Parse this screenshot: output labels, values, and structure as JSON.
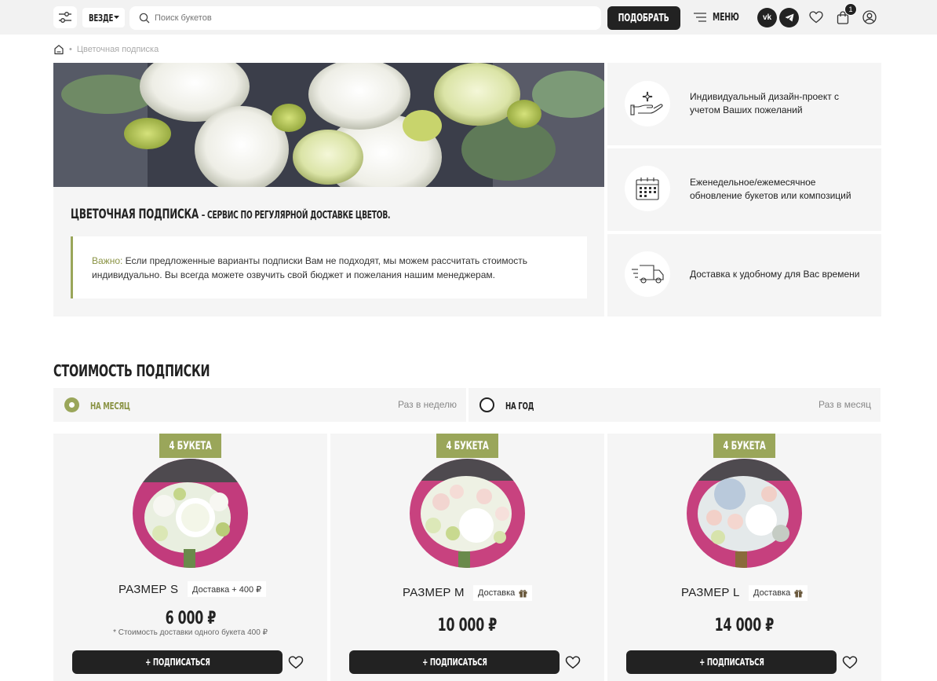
{
  "header": {
    "where_label": "ВЕЗДЕ",
    "search_placeholder": "Поиск букетов",
    "pick_label": "ПОДОБРАТЬ",
    "menu_label": "МЕНЮ",
    "social_vk": "vk",
    "cart_count": "1"
  },
  "breadcrumb": {
    "separator": "•",
    "current": "Цветочная подписка"
  },
  "hero": {
    "title": "ЦВЕТОЧНАЯ ПОДПИСКА",
    "subtitle": "– СЕРВИС ПО РЕГУЛЯРНОЙ ДОСТАВКЕ ЦВЕТОВ.",
    "note_label": "Важно:",
    "note_text": " Если предложенные варианты подписки Вам не подходят, мы можем рассчитать стоимость индивидуально. Вы всегда можете озвучить свой бюджет и пожелания нашим менеджерам."
  },
  "features": [
    {
      "text": "Индивидуальный дизайн-проект с учетом Ваших пожеланий",
      "icon": "hand-flower-icon"
    },
    {
      "text": "Еженедельное/ежемесячное обновление букетов или композиций",
      "icon": "calendar-icon"
    },
    {
      "text": "Доставка к удобному для Вас времени",
      "icon": "delivery-truck-icon"
    }
  ],
  "pricing": {
    "title": "СТОИМОСТЬ ПОДПИСКИ",
    "periods": [
      {
        "label": "НА МЕСЯЦ",
        "freq": "Раз в неделю",
        "selected": true
      },
      {
        "label": "НА ГОД",
        "freq": "Раз в месяц",
        "selected": false
      }
    ],
    "cards": [
      {
        "tag": "4 БУКЕТА",
        "size": "РАЗМЕР S",
        "delivery": "Доставка + 400 ₽",
        "price": "6 000 ₽",
        "footnote": "* Стоимость доставки одного букета 400 ₽",
        "button": "+ ПОДПИСАТЬСЯ"
      },
      {
        "tag": "4 БУКЕТА",
        "size": "РАЗМЕР M",
        "delivery": "Доставка",
        "price": "10 000 ₽",
        "footnote": "",
        "button": "+ ПОДПИСАТЬСЯ"
      },
      {
        "tag": "4 БУКЕТА",
        "size": "РАЗМЕР L",
        "delivery": "Доставка",
        "price": "14 000 ₽",
        "footnote": "",
        "button": "+ ПОДПИСАТЬСЯ"
      }
    ]
  },
  "colors": {
    "accent": "#9aa65a",
    "dark": "#222222",
    "panel": "#f5f5f5"
  }
}
